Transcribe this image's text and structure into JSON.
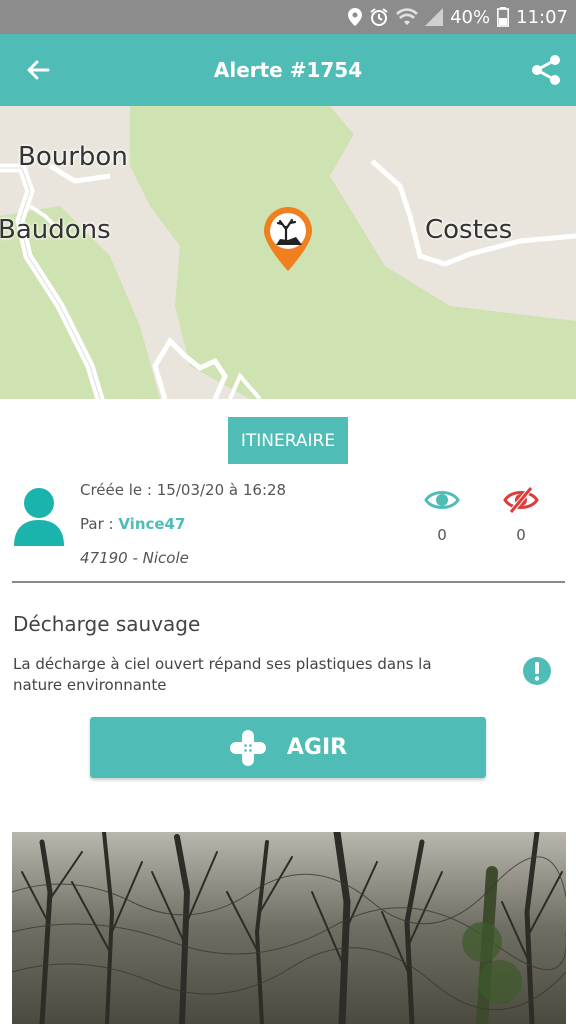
{
  "status_bar": {
    "battery": "40%",
    "time": "11:07",
    "icons": [
      "location-icon",
      "alarm-icon",
      "wifi-icon",
      "signal-icon",
      "battery-icon"
    ]
  },
  "app_bar": {
    "title": "Alerte #1754",
    "back_icon": "arrow-left-icon",
    "share_icon": "share-icon"
  },
  "map": {
    "labels": {
      "bourbon": "Bourbon",
      "baudons": "Baudons",
      "costes": "Costes"
    },
    "marker_icon": "dumpsite-marker-icon"
  },
  "itinerary_button": "ITINERAIRE",
  "alert": {
    "created_label": "Créée le : ",
    "created_value": "15/03/20 à 16:28",
    "by_label": "Par : ",
    "author": "Vince47",
    "location": "47190 - Nicole",
    "seen_count": "0",
    "hidden_count": "0",
    "type": "Décharge sauvage",
    "description": "La décharge à ciel ouvert répand ses plastiques dans la nature environnante"
  },
  "agir_button": {
    "label": "AGIR",
    "icon": "bandage-cross-icon"
  },
  "colors": {
    "accent": "#4fbdb6",
    "marker": "#f07f1f",
    "hidden_eye": "#e03a3a",
    "statusbar": "#8c8c8c"
  }
}
